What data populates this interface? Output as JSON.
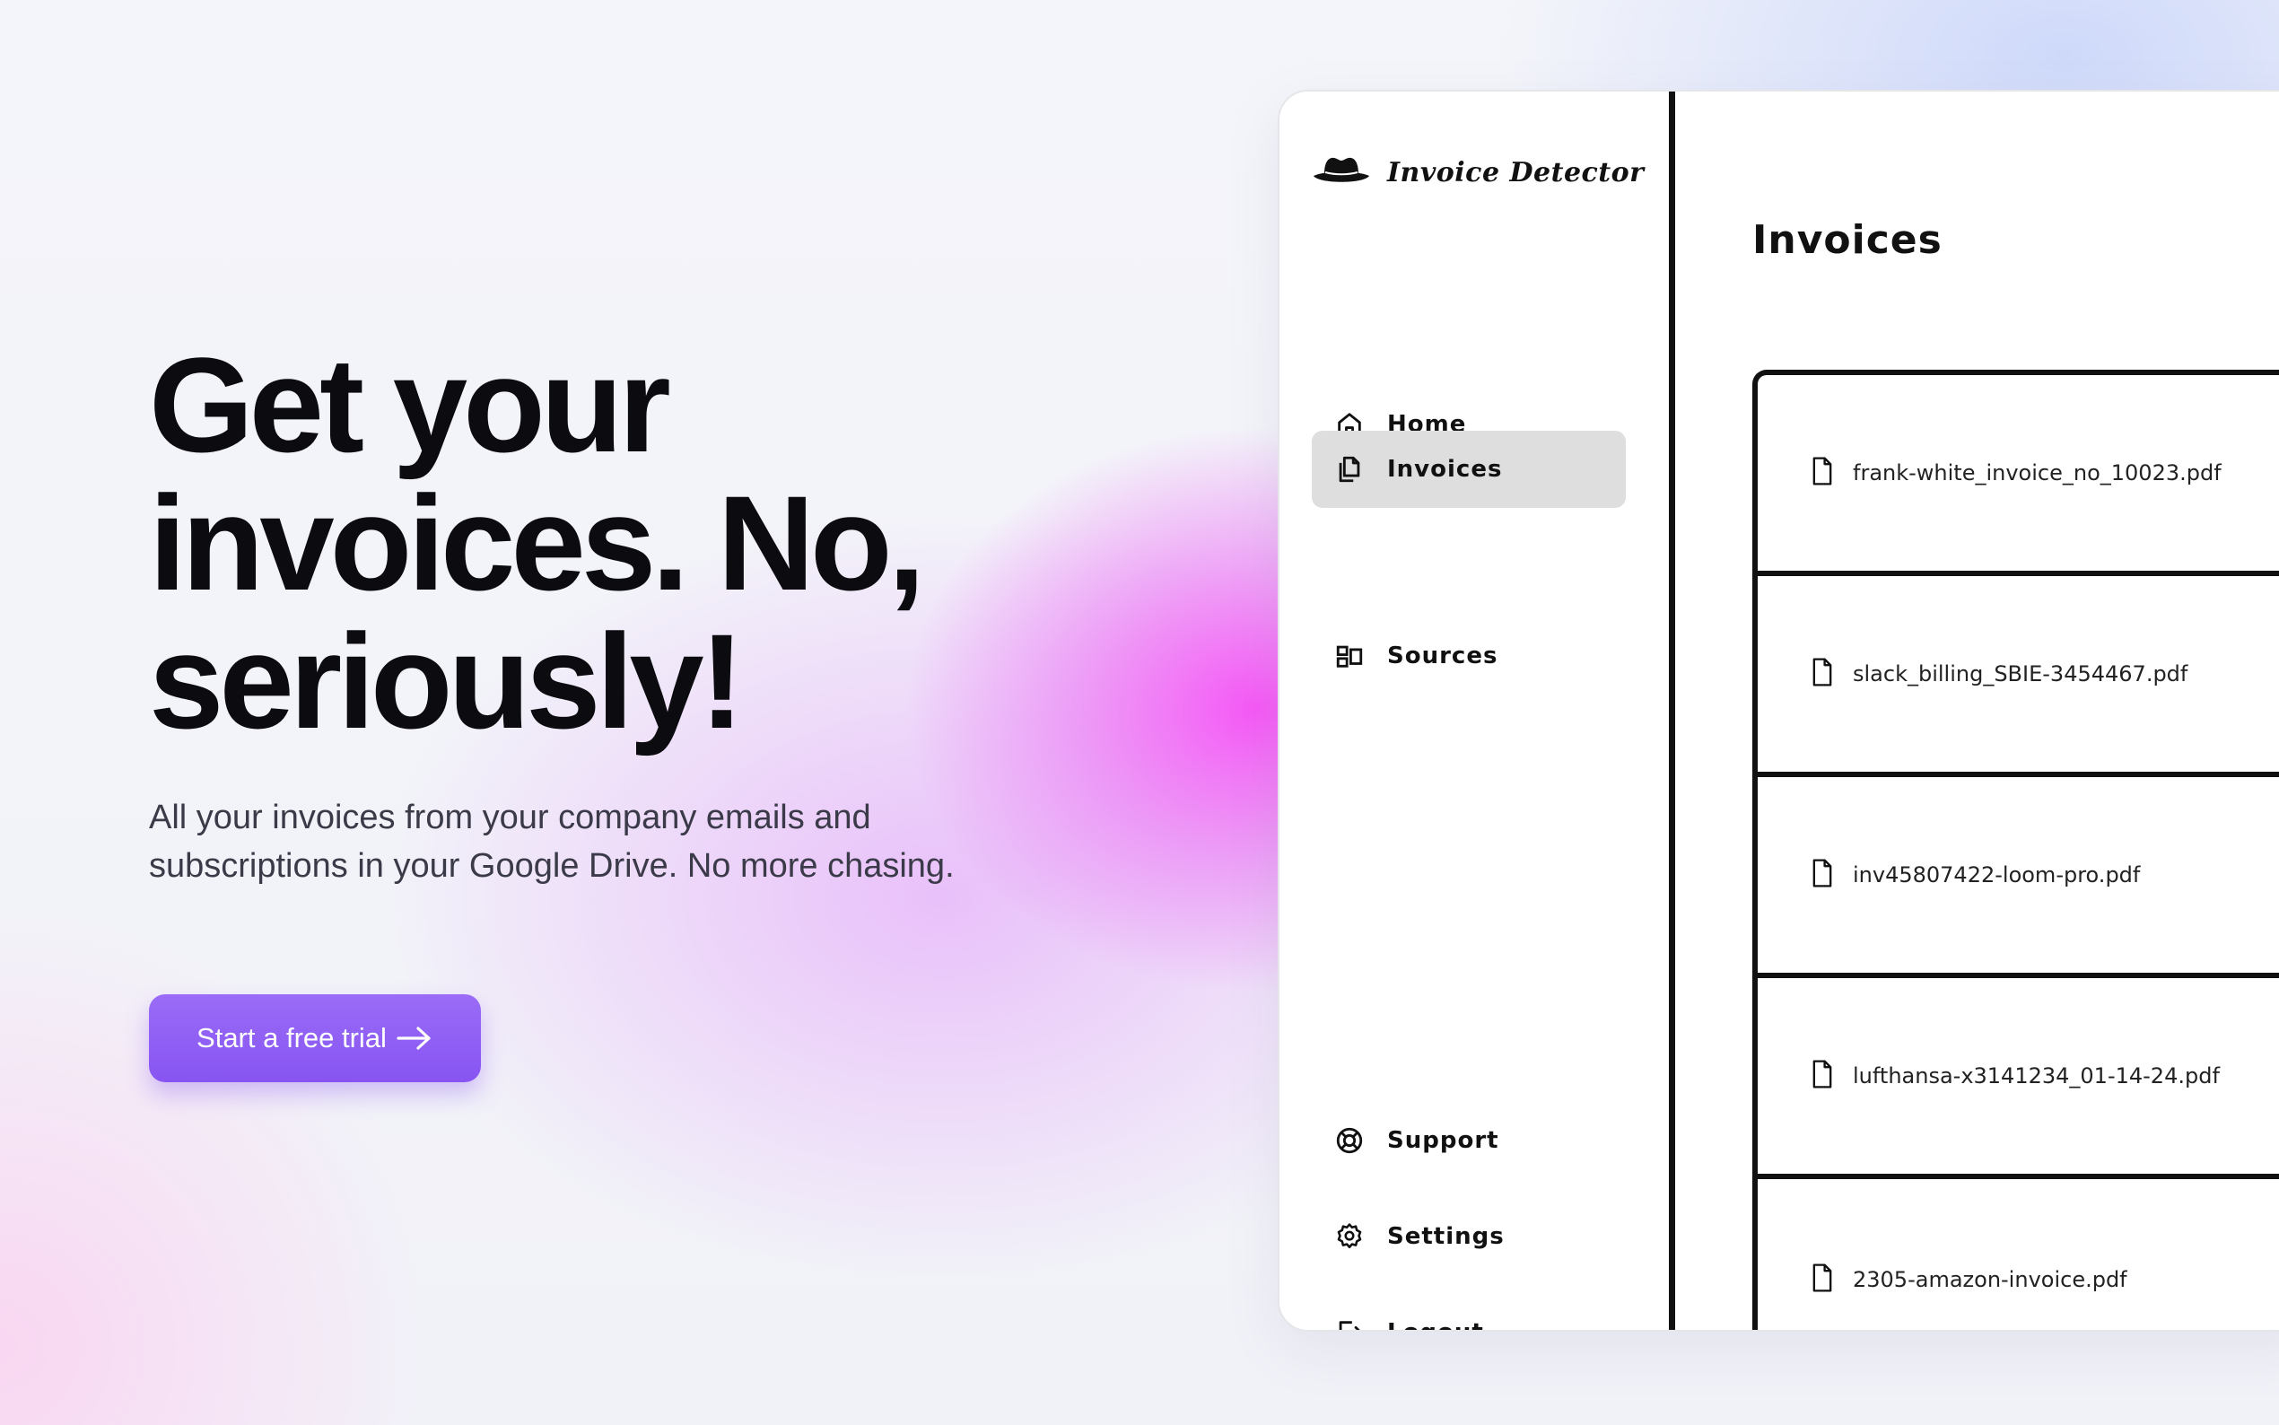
{
  "hero": {
    "title_line1": "Get your",
    "title_line2": "invoices. No,",
    "title_line3": "seriously!",
    "subtitle_line1": "All your invoices from your company emails and",
    "subtitle_line2": "subscriptions in your Google Drive. No more chasing.",
    "cta_label": "Start a free trial",
    "cta_icon": "arrow-right-icon",
    "accent_color": "#8b5cf6"
  },
  "app": {
    "logo_text": "Invoice Detector",
    "logo_icon": "detective-hat-icon",
    "nav_items": [
      {
        "label": "Home",
        "icon": "home-icon",
        "active": false
      },
      {
        "label": "Invoices",
        "icon": "documents-icon",
        "active": true
      },
      {
        "label": "Sources",
        "icon": "sources-icon",
        "active": false
      }
    ],
    "bottom_nav_items": [
      {
        "label": "Support",
        "icon": "lifebuoy-icon"
      },
      {
        "label": "Settings",
        "icon": "gear-icon"
      },
      {
        "label": "Logout",
        "icon": "logout-icon"
      }
    ],
    "page_title": "Invoices",
    "invoices": [
      {
        "name": "frank-white_invoice_no_10023.pdf",
        "icon": "file-icon"
      },
      {
        "name": "slack_billing_SBIE-3454467.pdf",
        "icon": "file-icon"
      },
      {
        "name": "inv45807422-loom-pro.pdf",
        "icon": "file-icon"
      },
      {
        "name": "lufthansa-x3141234_01-14-24.pdf",
        "icon": "file-icon"
      },
      {
        "name": "2305-amazon-invoice.pdf",
        "icon": "file-icon"
      }
    ]
  }
}
